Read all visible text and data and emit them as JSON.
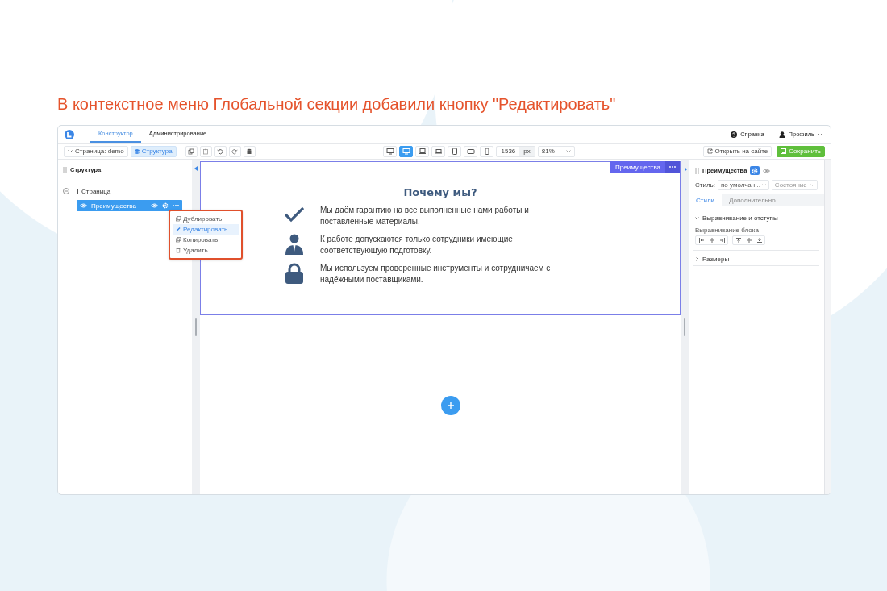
{
  "headline": "В контекстное меню Глобальной секции добавили кнопку \"Редактировать\"",
  "topbar": {
    "tabs": [
      {
        "label": "Конструктор",
        "selected": true
      },
      {
        "label": "Администрирование",
        "selected": false
      }
    ],
    "help": "Справка",
    "profile": "Профиль"
  },
  "toolbar": {
    "page_select": "Страница: demo",
    "structure_button": {
      "label": "Структура",
      "selected": true
    },
    "devices": [
      {
        "kind": "monitor",
        "selected": false
      },
      {
        "kind": "monitor",
        "selected": true
      },
      {
        "kind": "laptop",
        "selected": false
      },
      {
        "kind": "laptop-small",
        "selected": false
      },
      {
        "kind": "tablet",
        "selected": false
      },
      {
        "kind": "tablet-landscape",
        "selected": false
      },
      {
        "kind": "phone",
        "selected": false
      }
    ],
    "width_value": "1536",
    "width_unit": "px",
    "zoom": "81%",
    "open_site": "Открыть на сайте",
    "save": "Сохранить"
  },
  "structure": {
    "title": "Структура",
    "tree": [
      {
        "label": "Страница",
        "checked": false,
        "expanded": true,
        "children": [
          {
            "label": "Преимущества",
            "selected": true
          }
        ]
      }
    ],
    "context_menu": [
      {
        "kind": "duplicate",
        "label": "Дублировать",
        "selected": false
      },
      {
        "kind": "edit",
        "label": "Редактировать",
        "selected": true
      },
      {
        "kind": "copy",
        "label": "Копировать",
        "selected": false
      },
      {
        "kind": "delete",
        "label": "Удалить",
        "selected": false
      }
    ]
  },
  "canvas": {
    "section_tag": "Преимущества",
    "heading": "Почему мы?",
    "features": [
      {
        "kind": "check",
        "text": "Мы даём гарантию на все выполненные нами работы и поставленные материалы."
      },
      {
        "kind": "person",
        "text": "К работе допускаются только сотрудники имеющие соответствующую подготовку."
      },
      {
        "kind": "lock",
        "text": "Мы используем проверенные инструменты и сотрудничаем с надёжными поставщиками."
      }
    ]
  },
  "properties": {
    "title": "Преимущества",
    "style_label": "Стиль:",
    "style_value": "по умолчан...",
    "state_placeholder": "Состояние",
    "tabs": [
      {
        "label": "Стили",
        "selected": true
      },
      {
        "label": "Дополнительно",
        "selected": false
      }
    ],
    "sections": [
      {
        "label": "Выравнивание и отступы",
        "expanded": true,
        "subtitle": "Выравнивание блока"
      },
      {
        "label": "Размеры",
        "expanded": false
      }
    ]
  }
}
